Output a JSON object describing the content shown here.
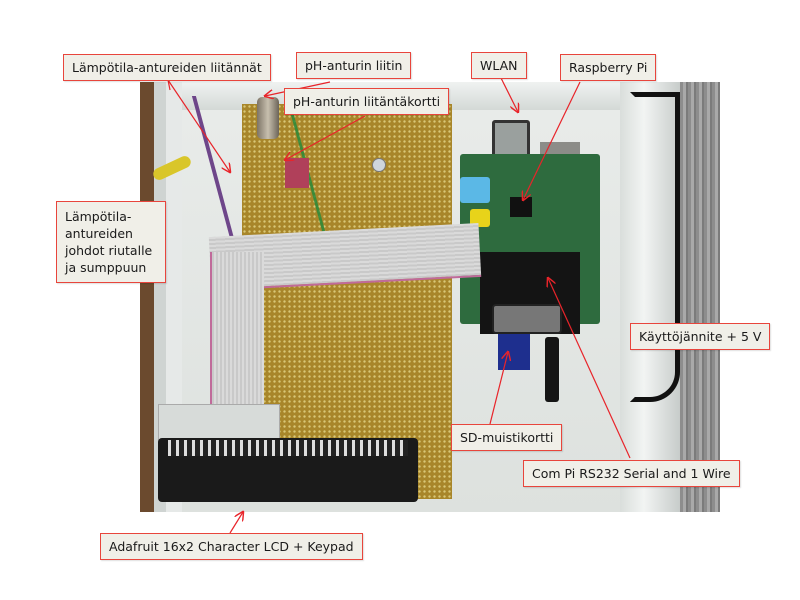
{
  "figure": {
    "description": "Annotated photo of an enclosure with Raspberry Pi and peripherals",
    "label_border_color": "#e8453c",
    "label_fill_color": "#f0efe8",
    "arrow_color": "#e8242a"
  },
  "labels": {
    "temp_sensor_connectors": "Lämpötila-antureiden liitännät",
    "ph_sensor_connector": "pH-anturin liitin",
    "ph_sensor_interface_board": "pH-anturin liitäntäkortti",
    "wlan": "WLAN",
    "raspberry_pi": "Raspberry Pi",
    "temp_sensor_wires": "Lämpötila-antureiden johdot riutalle ja sumppuun",
    "supply_voltage": "Käyttöjännite + 5 V",
    "sd_card": "SD-muistikortti",
    "com_pi": "Com Pi RS232 Serial and 1 Wire",
    "lcd_keypad": "Adafruit 16x2 Character LCD + Keypad"
  }
}
